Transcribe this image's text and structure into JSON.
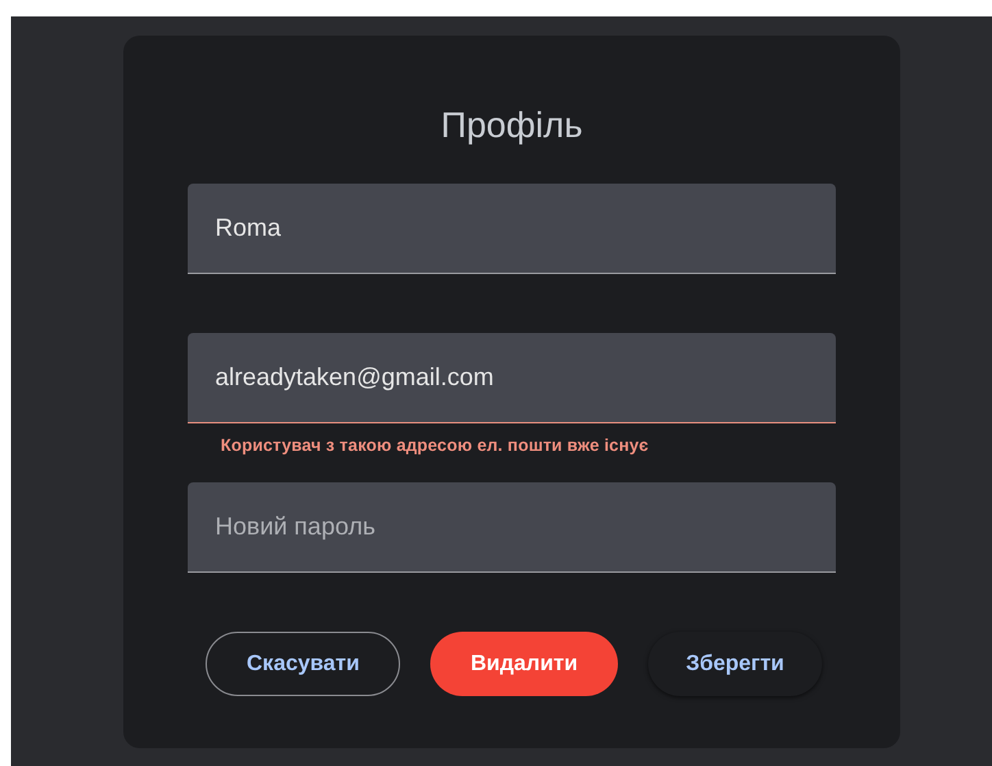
{
  "title": "Профіль",
  "fields": [
    {
      "value": "Roma",
      "error": false
    },
    {
      "value": "alreadytaken@gmail.com",
      "error": true,
      "error_text": "Користувач з такою адресою ел. пошти вже існує"
    },
    {
      "placeholder": "Новий пароль",
      "error": false
    }
  ],
  "buttons": [
    {
      "label": "Скасувати",
      "kind": "outlined"
    },
    {
      "label": "Видалити",
      "kind": "danger"
    },
    {
      "label": "Зберегти",
      "kind": "elevated"
    }
  ]
}
